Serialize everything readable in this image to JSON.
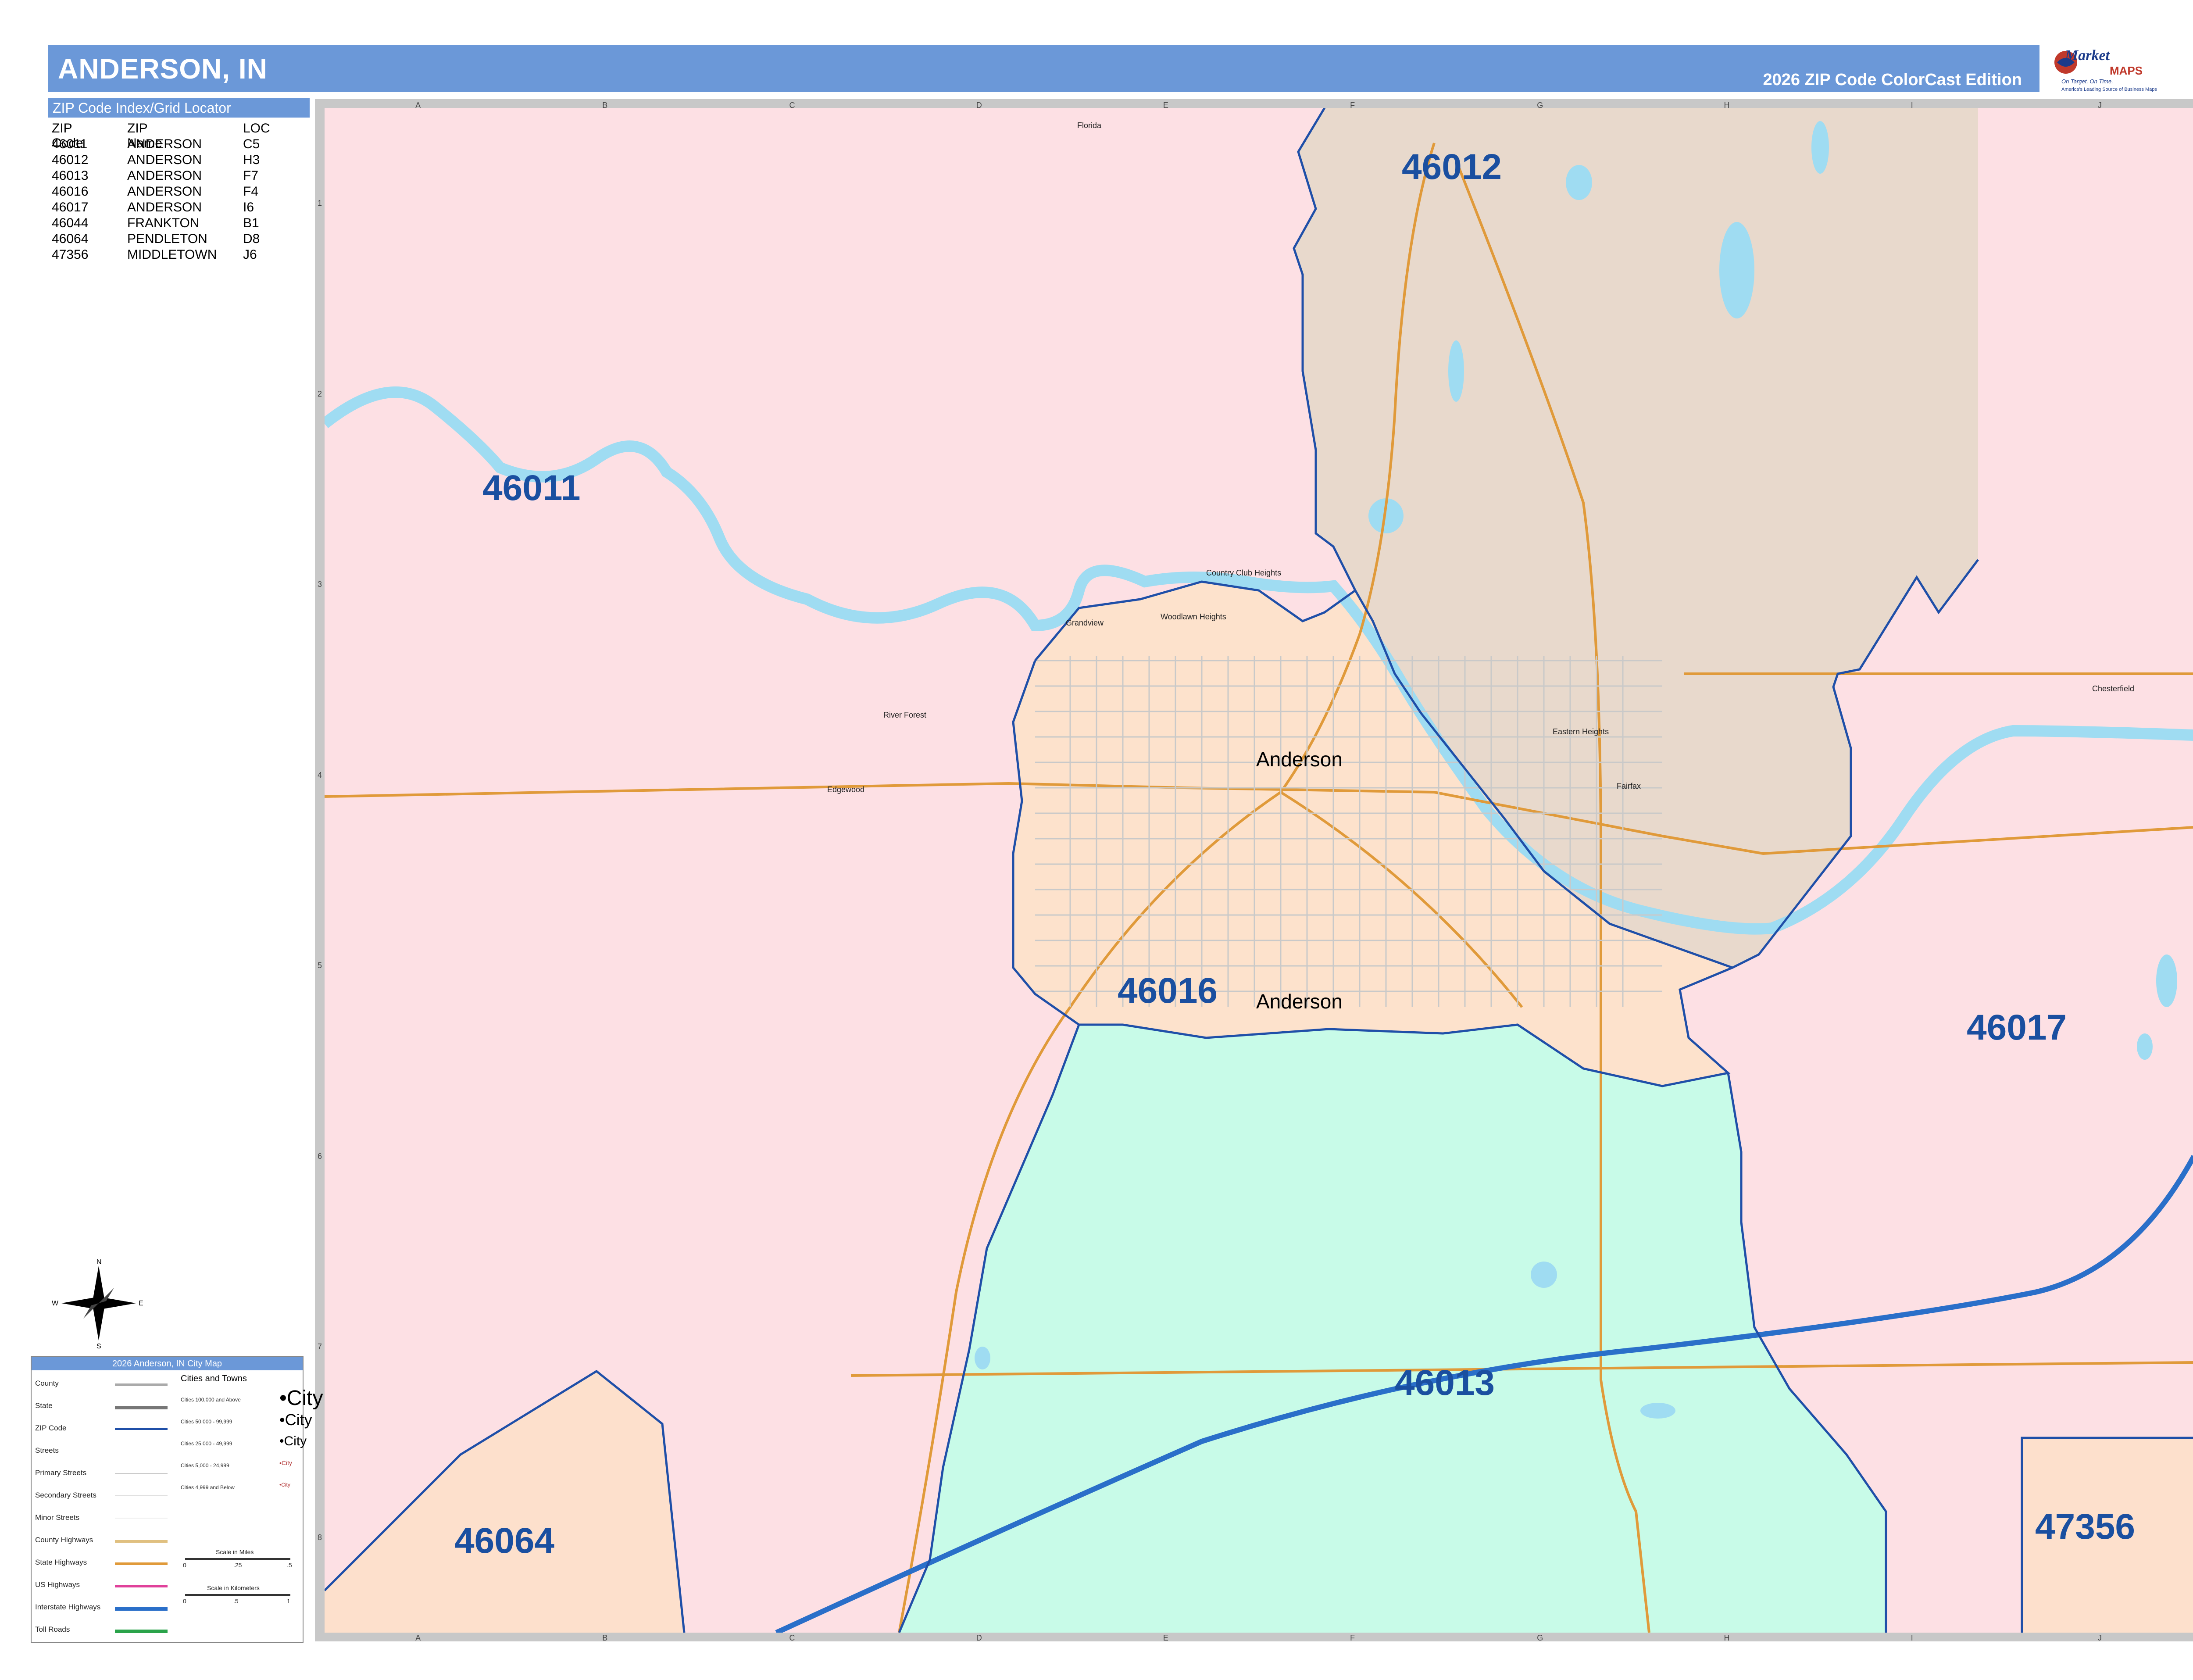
{
  "header": {
    "title": "ANDERSON, IN",
    "edition": "2026 ZIP Code ColorCast Edition"
  },
  "logo": {
    "name": "Market",
    "maps": "MAPS",
    "tagline": "On Target. On Time.",
    "subtitle": "America's Leading Source of Business Maps"
  },
  "index": {
    "heading": "ZIP Code Index/Grid Locator",
    "columns": [
      "ZIP Code",
      "ZIP Name",
      "LOC"
    ],
    "rows": [
      [
        "46011",
        "ANDERSON",
        "C5"
      ],
      [
        "46012",
        "ANDERSON",
        "H3"
      ],
      [
        "46013",
        "ANDERSON",
        "F7"
      ],
      [
        "46016",
        "ANDERSON",
        "F4"
      ],
      [
        "46017",
        "ANDERSON",
        "I6"
      ],
      [
        "46044",
        "FRANKTON",
        "B1"
      ],
      [
        "46064",
        "PENDLETON",
        "D8"
      ],
      [
        "47356",
        "MIDDLETOWN",
        "J6"
      ]
    ]
  },
  "grid": {
    "columns": [
      "A",
      "B",
      "C",
      "D",
      "E",
      "F",
      "G",
      "H",
      "I",
      "J"
    ],
    "rows": [
      "1",
      "2",
      "3",
      "4",
      "5",
      "6",
      "7",
      "8"
    ]
  },
  "zips": {
    "z46011": "46011",
    "z46012": "46012",
    "z46016": "46016",
    "z46017": "46017",
    "z46013": "46013",
    "z46064": "46064",
    "z47356": "47356"
  },
  "zip_colors": {
    "46011": "#fde0e4",
    "46012": "#e8d9cc",
    "46016": "#fde2cc",
    "46017": "#fde0e4",
    "46013": "#c8fbe8",
    "46064": "#fde0cc",
    "47356": "#fde0cc"
  },
  "places": {
    "anderson": "Anderson",
    "florida": "Florida",
    "country_club": "Country Club Heights",
    "woodlawn": "Woodlawn Heights",
    "grandview": "Grandview",
    "river_forest": "River Forest",
    "edgewood": "Edgewood",
    "eastern_heights": "Eastern Heights",
    "fairfax": "Fairfax",
    "chesterfield": "Chesterfield"
  },
  "legend": {
    "heading": "2026 Anderson, IN City Map",
    "items": [
      "County",
      "State",
      "ZIP Code",
      "Streets",
      "Primary Streets",
      "Secondary Streets",
      "Minor Streets",
      "County Highways",
      "State Highways",
      "US Highways",
      "Interstate Highways",
      "Toll Roads"
    ],
    "cities_heading": "Cities and Towns",
    "populations": [
      "Cities 100,000 and Above",
      "Cities 50,000 - 99,999",
      "Cities 25,000 - 49,999",
      "Cities 5,000 - 24,999",
      "Cities 4,999 and Below"
    ],
    "city_sample": "City",
    "scale_miles": "Scale in Miles",
    "scale_km": "Scale in Kilometers",
    "miles_ticks": [
      "0",
      ".25",
      ".5"
    ],
    "km_ticks": [
      "0",
      ".5",
      "1"
    ]
  },
  "compass": {
    "n": "N",
    "s": "S",
    "e": "E",
    "w": "W"
  },
  "colors": {
    "header_blue": "#6b98d8",
    "zip_border": "#1f4fa8",
    "water": "#9fdcf2",
    "highway": "#e09a3a",
    "interstate": "#2a6fc9"
  }
}
